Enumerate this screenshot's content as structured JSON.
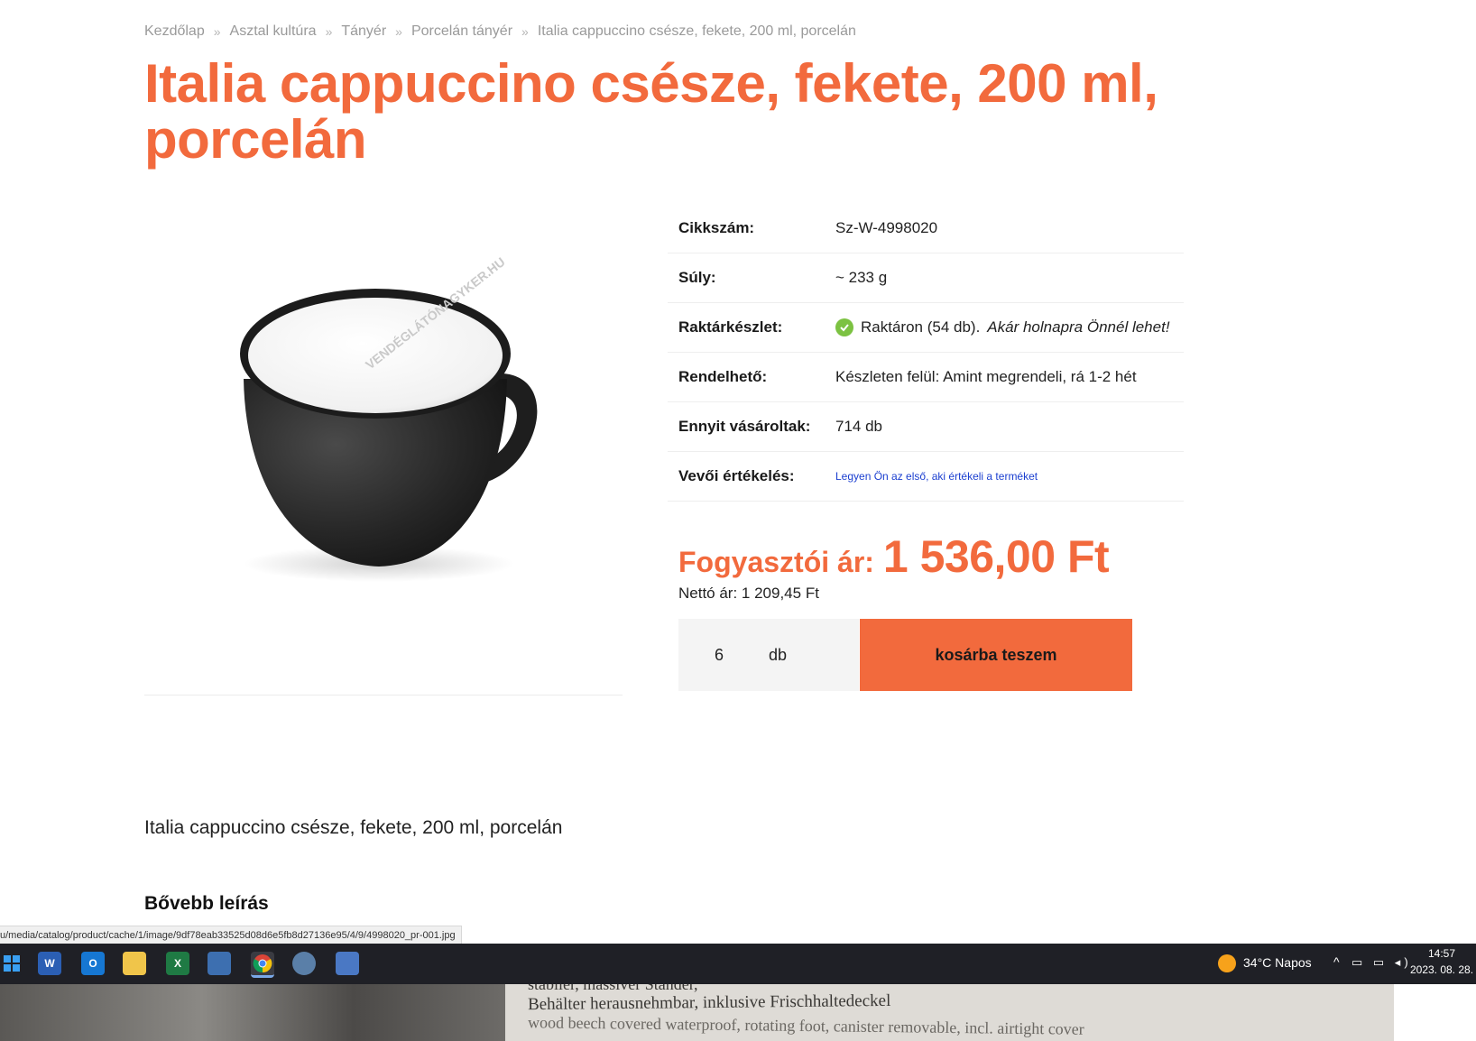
{
  "breadcrumb": [
    "Kezdőlap",
    "Asztal kultúra",
    "Tányér",
    "Porcelán tányér",
    "Italia cappuccino csésze, fekete, 200 ml, porcelán"
  ],
  "breadcrumb_separator": "»",
  "product": {
    "title": "Italia cappuccino csésze, fekete, 200 ml, porcelán",
    "image_watermark": "VENDÉGLÁTÓNAGYKER.HU"
  },
  "specs": {
    "sku_label": "Cikkszám:",
    "sku_value": "Sz-W-4998020",
    "weight_label": "Súly:",
    "weight_value": "~ 233 g",
    "stock_label": "Raktárkészlet:",
    "stock_value": "Raktáron (54 db).",
    "stock_note": "Akár holnapra Önnél lehet!",
    "orderable_label": "Rendelhető:",
    "orderable_value": "Készleten felül: Amint megrendeli, rá 1-2 hét",
    "sold_label": "Ennyit vásároltak:",
    "sold_value": "714 db",
    "rating_label": "Vevői értékelés:",
    "rating_link": "Legyen Ön az első, aki értékeli a terméket"
  },
  "price": {
    "consumer_label": "Fogyasztói ár:",
    "consumer_value": "1 536,00 Ft",
    "net_text": "Nettó ár: 1 209,45 Ft"
  },
  "cart": {
    "quantity": "6",
    "unit": "db",
    "button_label": "kosárba teszem"
  },
  "description": {
    "short": "Italia cappuccino csésze, fekete, 200 ml, porcelán",
    "more_heading": "Bővebb leírás"
  },
  "status_url": "u/media/catalog/product/cache/1/image/9df78eab33525d08d6e5fb8d27136e95/4/9/4998020_pr-001.jpg",
  "taskbar": {
    "apps": [
      "windows-start",
      "word",
      "outlook",
      "file-explorer",
      "excel",
      "remote-desktop",
      "chrome",
      "app-globe",
      "calculator"
    ],
    "weather": "34°C  Napos",
    "time": "14:57",
    "date": "2023. 08. 28."
  },
  "photo_text": {
    "line0": "stabiler, massiver Ständer,",
    "line1": "Behälter herausnehmbar, inklusive Frischhaltedeckel",
    "line2": "wood beech covered waterproof, rotating foot, canister removable, incl. airtight cover"
  },
  "colors": {
    "accent": "#f26a3d",
    "stock_check": "#7cc242",
    "link": "#1b3fd0",
    "taskbar": "#1f2026"
  }
}
